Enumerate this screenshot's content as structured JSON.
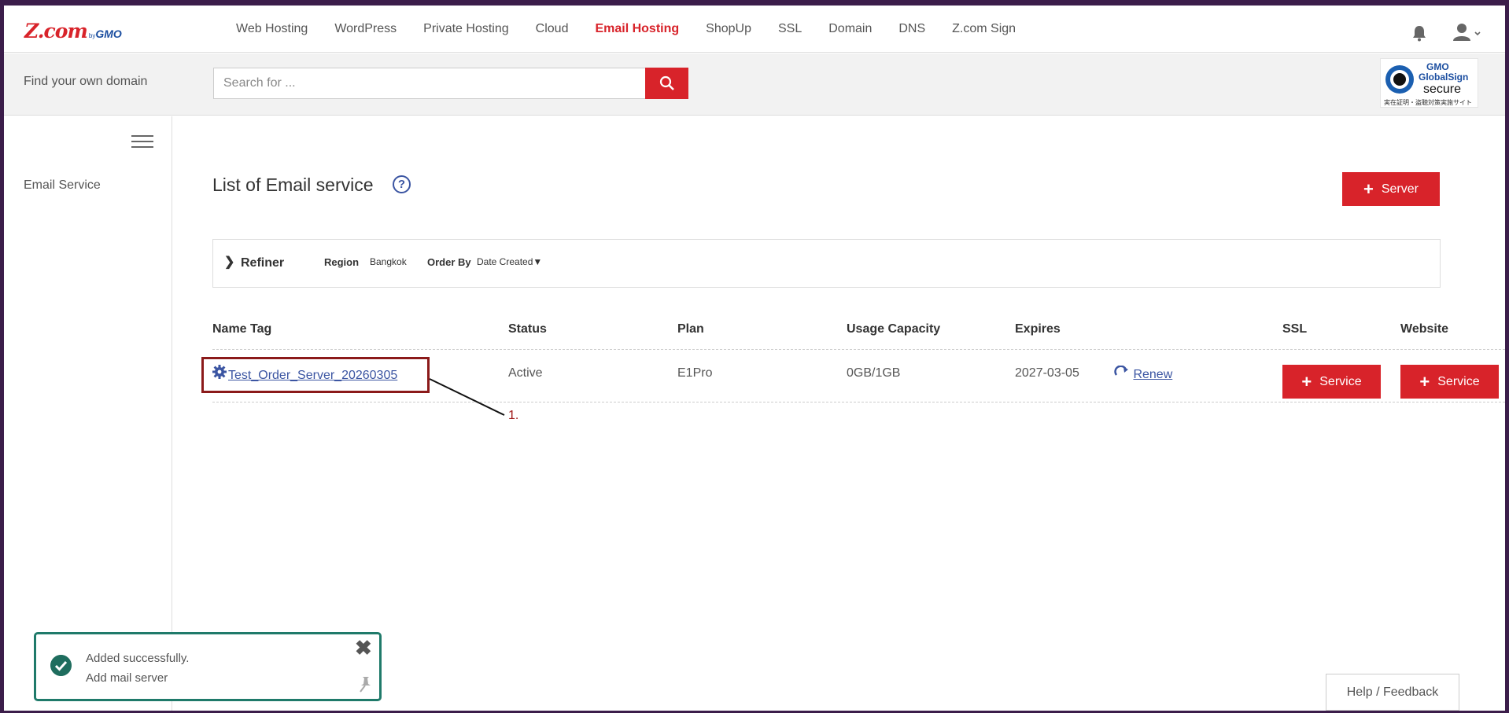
{
  "brand": {
    "logo_main": "Z.com",
    "logo_by": "by",
    "logo_gmo": "GMO"
  },
  "nav": {
    "items": [
      {
        "label": "Web Hosting",
        "active": false
      },
      {
        "label": "WordPress",
        "active": false
      },
      {
        "label": "Private Hosting",
        "active": false
      },
      {
        "label": "Cloud",
        "active": false
      },
      {
        "label": "Email Hosting",
        "active": true
      },
      {
        "label": "ShopUp",
        "active": false
      },
      {
        "label": "SSL",
        "active": false
      },
      {
        "label": "Domain",
        "active": false
      },
      {
        "label": "DNS",
        "active": false
      },
      {
        "label": "Z.com Sign",
        "active": false
      }
    ],
    "icons": [
      "bell-icon",
      "user-icon",
      "chevron-down-icon"
    ]
  },
  "search": {
    "label": "Find your own domain",
    "placeholder": "Search for ...",
    "button_icon": "search-icon"
  },
  "seal": {
    "line1": "GMO",
    "line2": "GlobalSign",
    "line3": "secure",
    "line4": "実在証明・盗聴対策実施サイト"
  },
  "sidebar": {
    "menu_icon": "hamburger-icon",
    "items": [
      {
        "label": "Email Service"
      }
    ]
  },
  "main": {
    "title": "List of Email service",
    "help_icon": "?",
    "add_server_label": "Server",
    "refiner": {
      "label": "Refiner",
      "region_label": "Region",
      "region_value": "Bangkok",
      "order_label": "Order By",
      "order_value": "Date Created▼"
    },
    "table": {
      "columns": [
        "Name Tag",
        "Status",
        "Plan",
        "Usage Capacity",
        "Expires",
        "SSL",
        "Website"
      ],
      "rows": [
        {
          "name_tag": "Test_Order_Server_20260305",
          "status": "Active",
          "plan": "E1Pro",
          "usage": "0GB/1GB",
          "expires": "2027-03-05",
          "renew_label": "Renew",
          "ssl_label": "Service",
          "website_label": "Service"
        }
      ]
    },
    "annotation": "1."
  },
  "toast": {
    "title": "Added successfully.",
    "message": "Add mail server",
    "close_symbol": "✖"
  },
  "feedback": {
    "label": "Help / Feedback"
  },
  "colors": {
    "accent_red": "#d8232a",
    "link_blue": "#3b55a2",
    "toast_green": "#1f7a6a"
  }
}
